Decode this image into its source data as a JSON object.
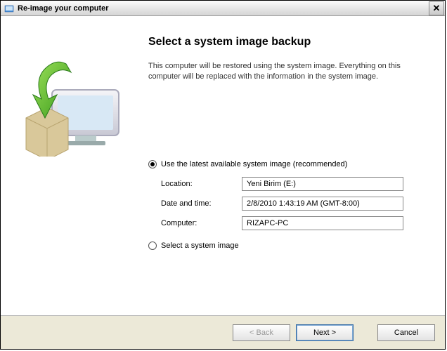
{
  "titlebar": {
    "title": "Re-image your computer",
    "close_label": "✕"
  },
  "wizard": {
    "heading": "Select a system image backup",
    "description": "This computer will be restored using the system image. Everything on this computer will be replaced with the information in the system image.",
    "radio_latest": "Use the latest available system image (recommended)",
    "radio_select": "Select a system image",
    "fields": {
      "location_label": "Location:",
      "location_value": "Yeni Birim  (E:)",
      "datetime_label": "Date and time:",
      "datetime_value": "2/8/2010 1:43:19 AM (GMT-8:00)",
      "computer_label": "Computer:",
      "computer_value": "RIZAPC-PC"
    }
  },
  "buttons": {
    "back": "< Back",
    "next": "Next >",
    "cancel": "Cancel"
  }
}
